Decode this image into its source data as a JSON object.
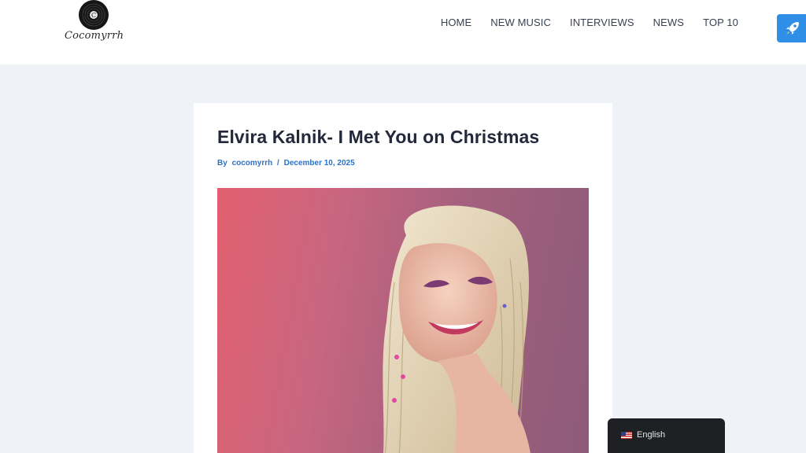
{
  "site": {
    "name": "Cocomyrrh",
    "logo_letter": "C"
  },
  "nav": {
    "items": [
      {
        "label": "HOME"
      },
      {
        "label": "NEW MUSIC"
      },
      {
        "label": "INTERVIEWS"
      },
      {
        "label": "NEWS"
      },
      {
        "label": "TOP 10"
      }
    ]
  },
  "article": {
    "title": "Elvira Kalnik- I Met You on Christmas",
    "byline_prefix": "By",
    "author": "cocomyrrh",
    "separator": "/",
    "date": "December 10, 2025",
    "image_icon": "portrait-photo"
  },
  "language": {
    "label": "English",
    "flag_icon": "us-flag-icon"
  },
  "colors": {
    "accent": "#2c71c8",
    "rocket_button": "#2f8ee5",
    "page_bg": "#eff3f7",
    "lang_bg": "#1f2024"
  }
}
